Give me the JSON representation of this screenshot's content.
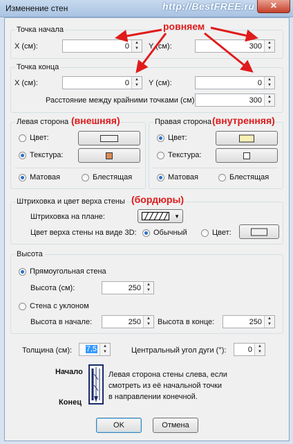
{
  "window": {
    "title": "Изменение стен",
    "watermark": "http://BestFREE.ru",
    "close_symbol": "✕"
  },
  "annotations": {
    "align": "ровняем",
    "outer": "(внешняя)",
    "inner": "(внутренняя)",
    "borders": "(бордюры)",
    "color": "#e01b1b"
  },
  "start_point": {
    "title": "Точка начала",
    "x_label": "X (см):",
    "x_value": "0",
    "y_label": "Y (см):",
    "y_value": "300"
  },
  "end_point": {
    "title": "Точка конца",
    "x_label": "X (см):",
    "x_value": "0",
    "y_label": "Y (см):",
    "y_value": "0",
    "distance_label": "Расстояние между крайними точками (см):",
    "distance_value": "300"
  },
  "left_side": {
    "title": "Левая сторона",
    "color_label": "Цвет:",
    "texture_label": "Текстура:",
    "matte_label": "Матовая",
    "glossy_label": "Блестящая",
    "color_swatch": "#f0f0f0",
    "texture_swatch": "#d98b5a",
    "selected_fill": "texture",
    "selected_finish": "matte"
  },
  "right_side": {
    "title": "Правая сторона",
    "color_label": "Цвет:",
    "texture_label": "Текстура:",
    "matte_label": "Матовая",
    "glossy_label": "Блестящая",
    "color_swatch": "#f7f1b5",
    "texture_swatch": "#ffffff",
    "selected_fill": "color",
    "selected_finish": "matte"
  },
  "pattern": {
    "title": "Штриховка и цвет верха стены",
    "plan_label": "Штриховка на плане:",
    "top_color_label": "Цвет верха стены на виде 3D:",
    "normal_label": "Обычный",
    "color_label": "Цвет:",
    "selected": "normal"
  },
  "height": {
    "title": "Высота",
    "rect_label": "Прямоугольная стена",
    "height_label": "Высота (см):",
    "height_value": "250",
    "sloped_label": "Стена с уклоном",
    "start_label": "Высота в начале:",
    "start_value": "250",
    "end_label": "Высота в конце:",
    "end_value": "250",
    "selected": "rectangular"
  },
  "thickness": {
    "label": "Толщина (см):",
    "value": "7,5",
    "arc_label": "Центральный угол дуги (°):",
    "arc_value": "0"
  },
  "hint": {
    "start": "Начало",
    "end": "Конец",
    "text_line1": "Левая сторона стены слева, если",
    "text_line2": "смотреть из её начальной точки",
    "text_line3": "в направлении конечной."
  },
  "buttons": {
    "ok": "OK",
    "cancel": "Отмена"
  }
}
